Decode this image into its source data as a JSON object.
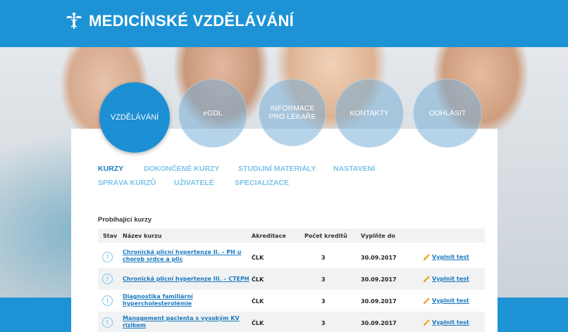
{
  "site": {
    "title": "MEDICÍNSKÉ VZDĚLÁVÁNÍ",
    "logo_icon": "caduceus-icon"
  },
  "nav": [
    {
      "label": "VZDĚLÁVÁNÍ",
      "active": true
    },
    {
      "label": "eGDL",
      "active": false
    },
    {
      "label": "INFORMACE PRO LÉKAŘE",
      "active": false
    },
    {
      "label": "KONTAKTY",
      "active": false
    },
    {
      "label": "ODHLÁSIT",
      "active": false
    }
  ],
  "tabs": [
    {
      "label": "KURZY",
      "active": true
    },
    {
      "label": "DOKONČENÉ KURZY",
      "active": false
    },
    {
      "label": "STUDIJNÍ MATERIÁLY",
      "active": false
    },
    {
      "label": "NASTAVENÍ",
      "active": false
    },
    {
      "label": "SPRÁVA KURZŮ",
      "active": false
    },
    {
      "label": "UŽIVATELÉ",
      "active": false
    },
    {
      "label": "SPECIALIZACE",
      "active": false
    }
  ],
  "section_title": "Probíhající kurzy",
  "table": {
    "headers": [
      "Stav",
      "Název kurzu",
      "Akreditace",
      "Počet kreditů",
      "Vyplňte do",
      ""
    ],
    "rows": [
      {
        "status": "!",
        "name": "Chronická plicní hypertenze II. – PH u chorob srdce a plic",
        "accreditation": "ČLK",
        "credits": "3",
        "due": "30.09.2017",
        "action": "Vyplnit test"
      },
      {
        "status": "!",
        "name": "Chronická plicní hypertenze III. – CTEPH",
        "accreditation": "ČLK",
        "credits": "3",
        "due": "30.09.2017",
        "action": "Vyplnit test"
      },
      {
        "status": "!",
        "name": "Diagnostika familiární hypercholesterolémie",
        "accreditation": "ČLK",
        "credits": "3",
        "due": "30.09.2017",
        "action": "Vyplnit test"
      },
      {
        "status": "!",
        "name": "Management pacienta s vysokým KV rizikem",
        "accreditation": "ČLK",
        "credits": "3",
        "due": "30.09.2017",
        "action": "Vyplnit test"
      }
    ]
  },
  "colors": {
    "brand_blue": "#1d93d6",
    "link_blue": "#1a79c0",
    "tab_inactive": "#7cc3ea"
  }
}
